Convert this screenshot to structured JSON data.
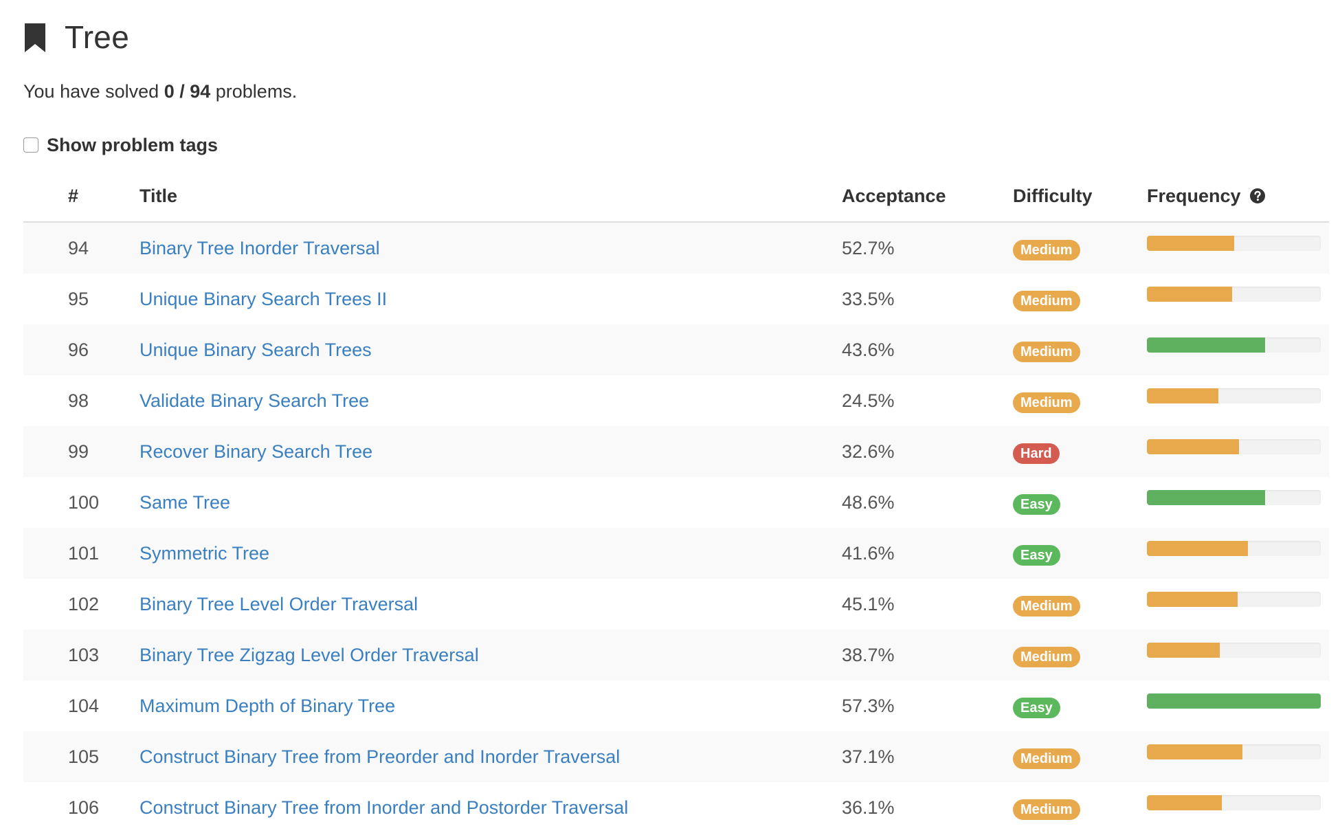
{
  "header": {
    "title": "Tree",
    "solved_prefix": "You have solved",
    "solved_count": "0 / 94",
    "solved_suffix": "problems."
  },
  "tags_toggle": {
    "label": "Show problem tags",
    "checked": false
  },
  "table": {
    "columns": [
      "#",
      "Title",
      "Acceptance",
      "Difficulty",
      "Frequency"
    ],
    "rows": [
      {
        "id": "94",
        "title": "Binary Tree Inorder Traversal",
        "acceptance": "52.7%",
        "difficulty": "Medium",
        "frequency": 0.5,
        "freq_color": "orange"
      },
      {
        "id": "95",
        "title": "Unique Binary Search Trees II",
        "acceptance": "33.5%",
        "difficulty": "Medium",
        "frequency": 0.49,
        "freq_color": "orange"
      },
      {
        "id": "96",
        "title": "Unique Binary Search Trees",
        "acceptance": "43.6%",
        "difficulty": "Medium",
        "frequency": 0.68,
        "freq_color": "green"
      },
      {
        "id": "98",
        "title": "Validate Binary Search Tree",
        "acceptance": "24.5%",
        "difficulty": "Medium",
        "frequency": 0.41,
        "freq_color": "orange"
      },
      {
        "id": "99",
        "title": "Recover Binary Search Tree",
        "acceptance": "32.6%",
        "difficulty": "Hard",
        "frequency": 0.53,
        "freq_color": "orange"
      },
      {
        "id": "100",
        "title": "Same Tree",
        "acceptance": "48.6%",
        "difficulty": "Easy",
        "frequency": 0.68,
        "freq_color": "green"
      },
      {
        "id": "101",
        "title": "Symmetric Tree",
        "acceptance": "41.6%",
        "difficulty": "Easy",
        "frequency": 0.58,
        "freq_color": "orange"
      },
      {
        "id": "102",
        "title": "Binary Tree Level Order Traversal",
        "acceptance": "45.1%",
        "difficulty": "Medium",
        "frequency": 0.52,
        "freq_color": "orange"
      },
      {
        "id": "103",
        "title": "Binary Tree Zigzag Level Order Traversal",
        "acceptance": "38.7%",
        "difficulty": "Medium",
        "frequency": 0.42,
        "freq_color": "orange"
      },
      {
        "id": "104",
        "title": "Maximum Depth of Binary Tree",
        "acceptance": "57.3%",
        "difficulty": "Easy",
        "frequency": 1.0,
        "freq_color": "green"
      },
      {
        "id": "105",
        "title": "Construct Binary Tree from Preorder and Inorder Traversal",
        "acceptance": "37.1%",
        "difficulty": "Medium",
        "frequency": 0.55,
        "freq_color": "orange"
      },
      {
        "id": "106",
        "title": "Construct Binary Tree from Inorder and Postorder Traversal",
        "acceptance": "36.1%",
        "difficulty": "Medium",
        "frequency": 0.43,
        "freq_color": "orange"
      }
    ]
  },
  "colors": {
    "link": "#3a7fc1",
    "medium": "#e8a94d",
    "hard": "#d35b4f",
    "easy": "#5cb85c",
    "freq_orange": "#e8a94d",
    "freq_green": "#5fb05f"
  },
  "icons": {
    "title_icon": "bookmark-icon",
    "frequency_help": "question-circle-icon"
  }
}
